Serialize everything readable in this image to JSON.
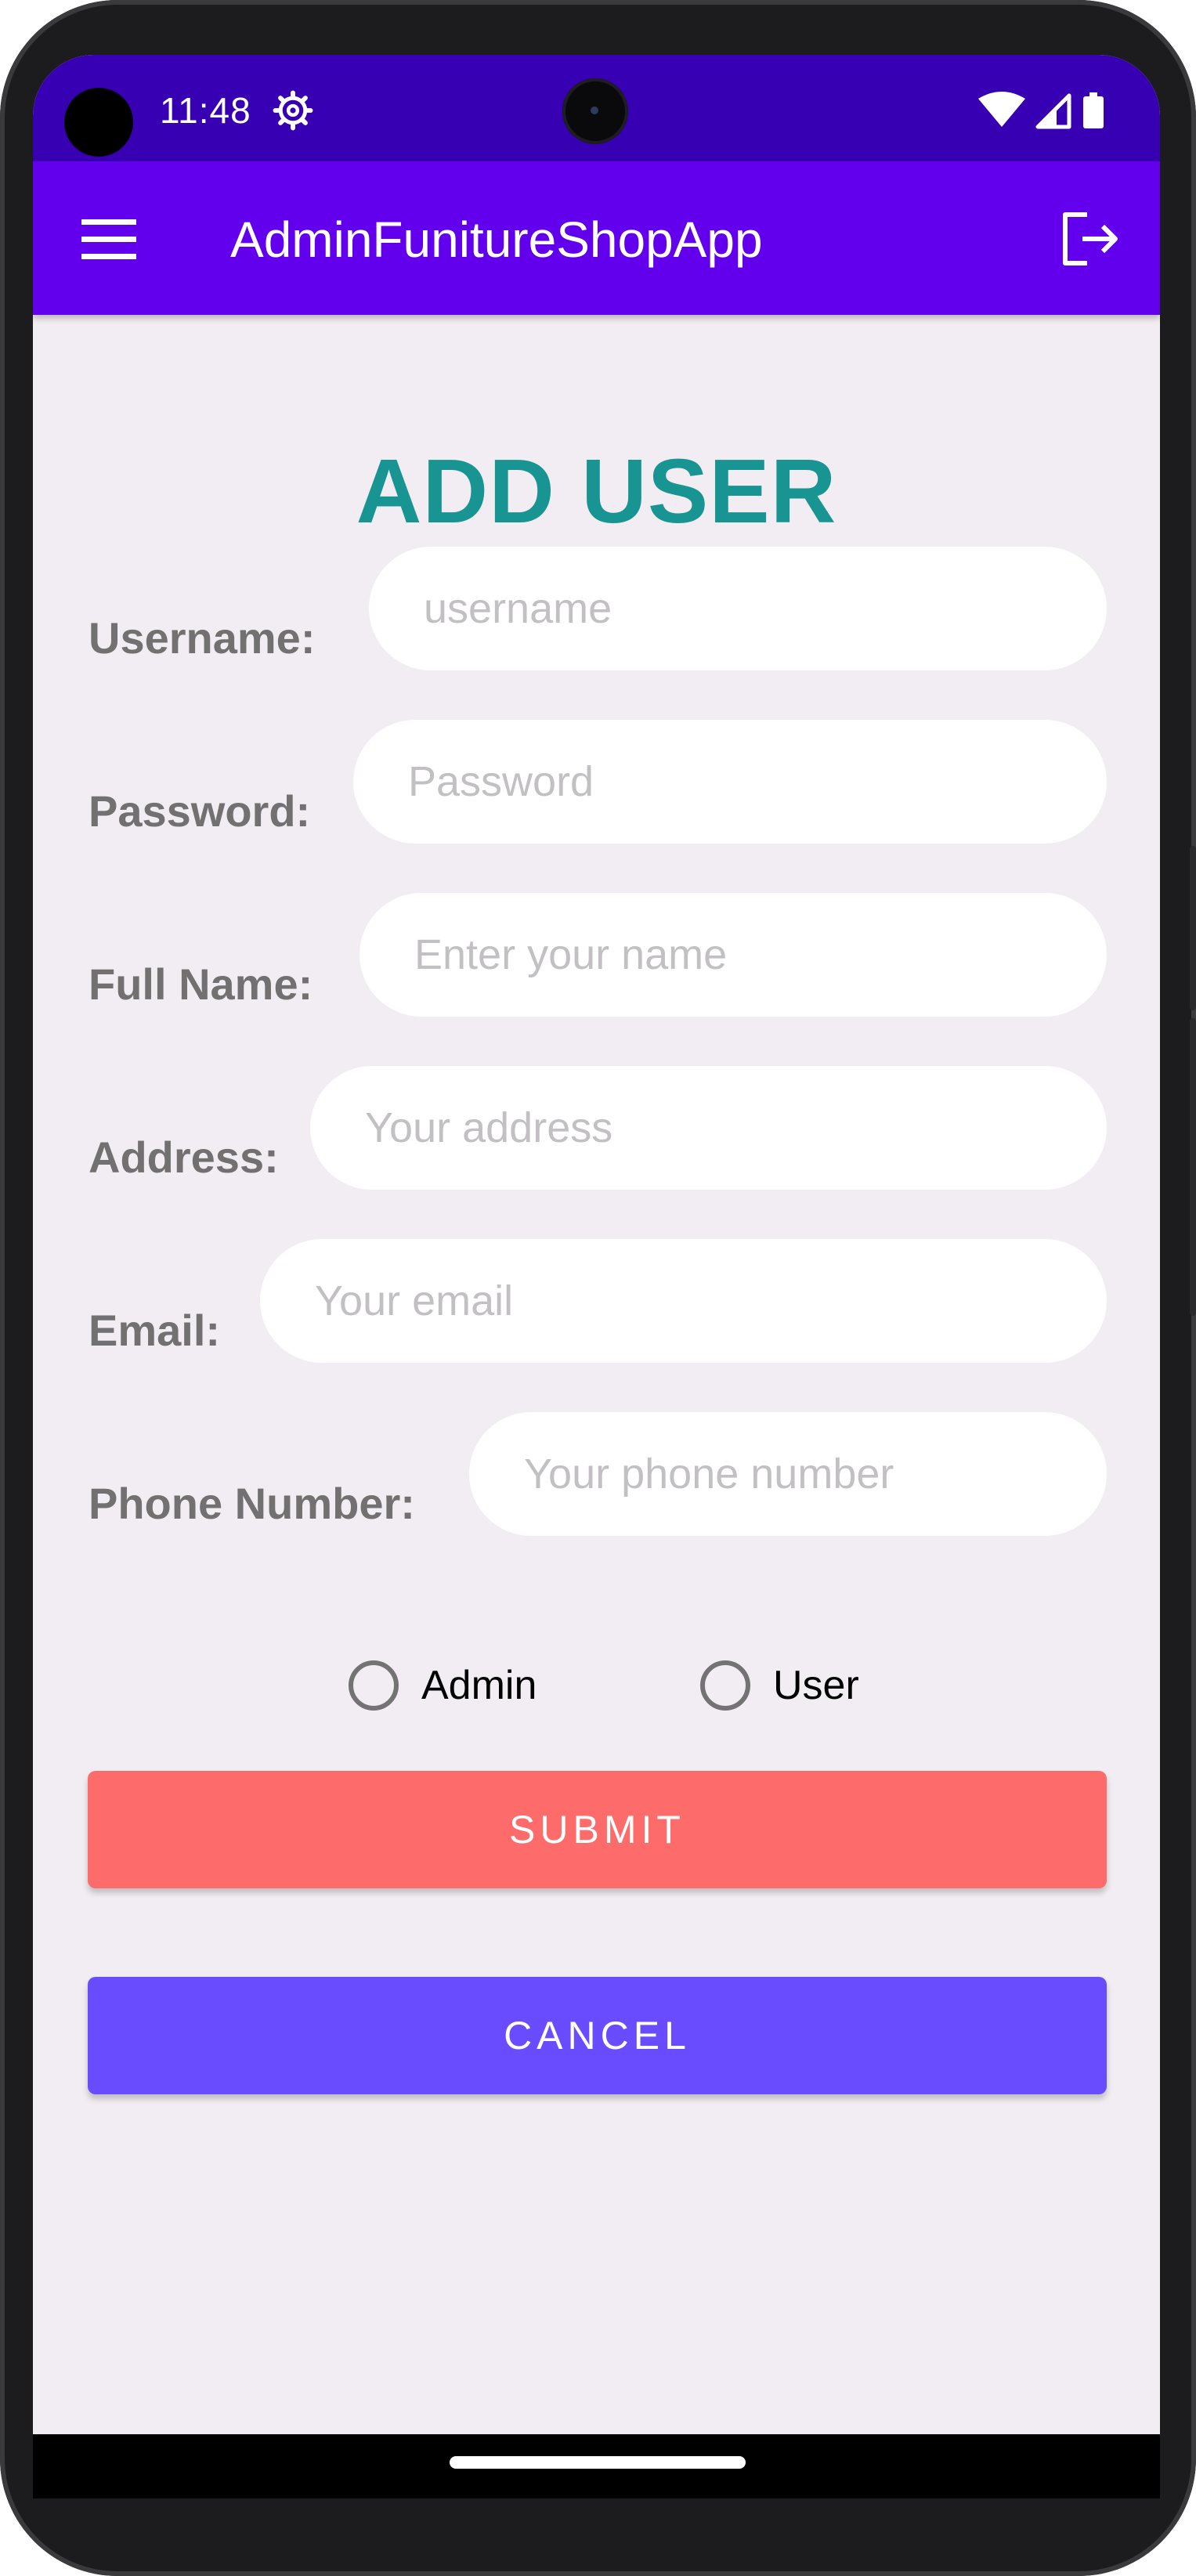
{
  "status_bar": {
    "time": "11:48",
    "icons": [
      "settings-gear-icon",
      "wifi-icon",
      "cell-signal-icon",
      "battery-icon"
    ]
  },
  "app_bar": {
    "menu_icon": "hamburger-menu-icon",
    "title": "AdminFunitureShopApp",
    "logout_icon": "logout-icon"
  },
  "page": {
    "title": "ADD USER"
  },
  "form": {
    "fields": [
      {
        "label": "Username:",
        "placeholder": "username",
        "value": ""
      },
      {
        "label": "Password:",
        "placeholder": "Password",
        "value": ""
      },
      {
        "label": "Full Name:",
        "placeholder": "Enter your name",
        "value": ""
      },
      {
        "label": "Address:",
        "placeholder": "Your address",
        "value": ""
      },
      {
        "label": "Email:",
        "placeholder": "Your email",
        "value": ""
      },
      {
        "label": "Phone Number:",
        "placeholder": "Your phone number",
        "value": ""
      }
    ],
    "roles": [
      {
        "label": "Admin",
        "selected": false
      },
      {
        "label": "User",
        "selected": false
      }
    ]
  },
  "buttons": {
    "submit": "SUBMIT",
    "cancel": "CANCEL"
  },
  "colors": {
    "status_bar": "#3700b3",
    "app_bar": "#6200ee",
    "title": "#189592",
    "label": "#727070",
    "submit": "#fd6c6a",
    "cancel": "#6a4cff",
    "background": "#f1edf2"
  }
}
